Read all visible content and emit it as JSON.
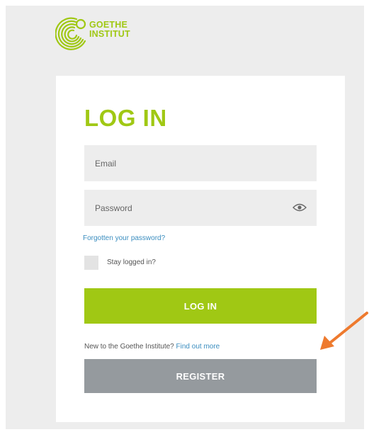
{
  "logo": {
    "line1": "GOETHE",
    "line2": "INSTITUT"
  },
  "login": {
    "title": "LOG IN",
    "email_placeholder": "Email",
    "password_placeholder": "Password",
    "forgot_link": "Forgotten your password?",
    "stay_logged_in": "Stay logged in?",
    "login_button": "LOG IN",
    "new_text": "New to the Goethe Institute?",
    "find_out_link": "Find out more",
    "register_button": "REGISTER"
  },
  "icons": {
    "password_toggle": "eye-icon",
    "annotation": "arrow-icon"
  },
  "colors": {
    "brand_green": "#a0c814",
    "link_blue": "#3a8dbf",
    "register_gray": "#959a9e",
    "page_background": "#ededed",
    "annotation_arrow": "#ee7a2e"
  }
}
